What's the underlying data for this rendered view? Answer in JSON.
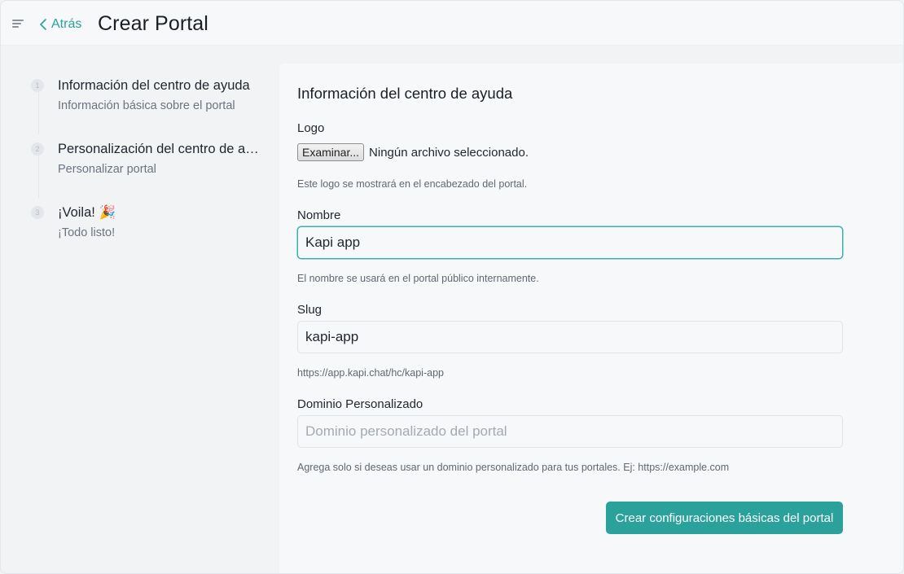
{
  "header": {
    "back_label": "Atrás",
    "title": "Crear Portal"
  },
  "steps": [
    {
      "index": "1",
      "title": "Información del centro de ayuda",
      "subtitle": "Información básica sobre el portal"
    },
    {
      "index": "2",
      "title": "Personalización del centro de ayuda",
      "subtitle": "Personalizar portal"
    },
    {
      "index": "3",
      "title": "¡Voila! 🎉",
      "subtitle": "¡Todo listo!"
    }
  ],
  "form": {
    "section_title": "Información del centro de ayuda",
    "logo": {
      "label": "Logo",
      "browse_button": "Examinar...",
      "file_status": "Ningún archivo seleccionado.",
      "help": "Este logo se mostrará en el encabezado del portal."
    },
    "name": {
      "label": "Nombre",
      "value": "Kapi app",
      "help": "El nombre se usará en el portal público internamente."
    },
    "slug": {
      "label": "Slug",
      "value": "kapi-app",
      "help": "https://app.kapi.chat/hc/kapi-app"
    },
    "domain": {
      "label": "Dominio Personalizado",
      "value": "",
      "placeholder": "Dominio personalizado del portal",
      "help": "Agrega solo si deseas usar un dominio personalizado para tus portales. Ej: https://example.com"
    },
    "submit_label": "Crear configuraciones básicas del portal"
  },
  "colors": {
    "accent": "#2ba19c",
    "background": "#f1f3f5",
    "panel": "#f7f8fa"
  }
}
